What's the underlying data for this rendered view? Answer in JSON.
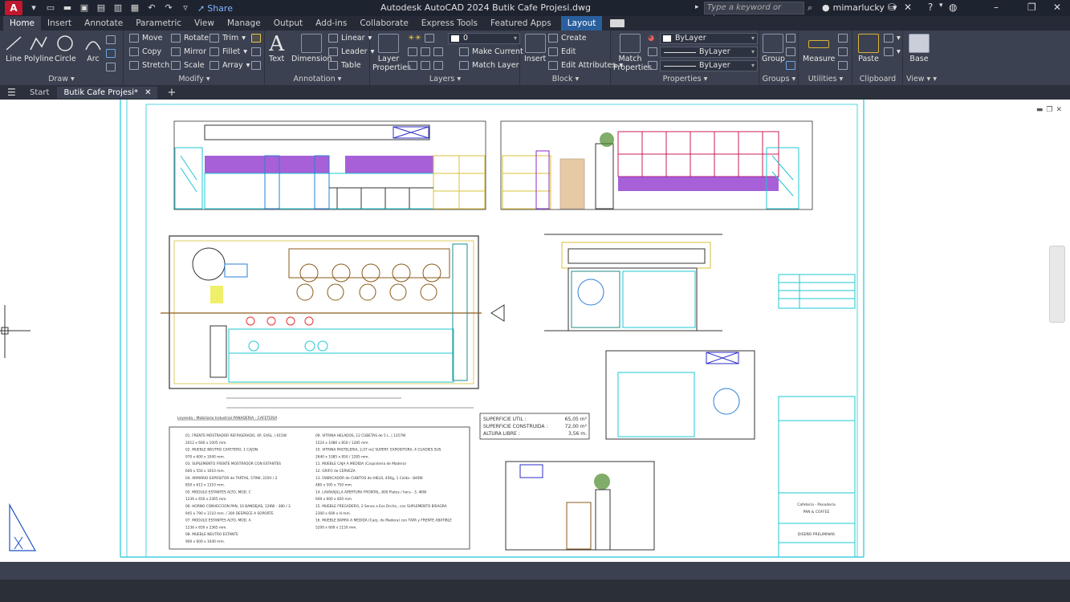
{
  "app": {
    "logo_letter": "A",
    "title": "Autodesk AutoCAD 2024    Butik Cafe Projesi.dwg",
    "share_label": "Share",
    "search_placeholder": "Type a keyword or phrase",
    "user_name": "mimarlucky"
  },
  "ribbon_tabs": [
    "Home",
    "Insert",
    "Annotate",
    "Parametric",
    "View",
    "Manage",
    "Output",
    "Add-ins",
    "Collaborate",
    "Express Tools",
    "Featured Apps",
    "Layout"
  ],
  "ribbon": {
    "draw": {
      "label": "Draw",
      "line": "Line",
      "polyline": "Polyline",
      "circle": "Circle",
      "arc": "Arc"
    },
    "modify": {
      "label": "Modify",
      "move": "Move",
      "rotate": "Rotate",
      "trim": "Trim",
      "copy": "Copy",
      "mirror": "Mirror",
      "fillet": "Fillet",
      "stretch": "Stretch",
      "scale": "Scale",
      "array": "Array"
    },
    "annotation": {
      "label": "Annotation",
      "text": "Text",
      "dimension": "Dimension",
      "linear": "Linear",
      "leader": "Leader",
      "table": "Table"
    },
    "layers": {
      "label": "Layers",
      "layer_properties": "Layer Properties",
      "current_layer": "0",
      "make_current": "Make Current",
      "match_layer": "Match Layer"
    },
    "block": {
      "label": "Block",
      "insert": "Insert",
      "create": "Create",
      "edit": "Edit",
      "edit_attributes": "Edit Attributes"
    },
    "properties": {
      "label": "Properties",
      "match_properties": "Match Properties",
      "color": "ByLayer",
      "linetype": "ByLayer",
      "lineweight": "ByLayer"
    },
    "groups": {
      "label": "Groups",
      "group": "Group"
    },
    "utilities": {
      "label": "Utilities",
      "measure": "Measure"
    },
    "clipboard": {
      "label": "Clipboard",
      "paste": "Paste"
    },
    "view": {
      "label": "View",
      "base": "Base"
    }
  },
  "file_tabs": {
    "start": "Start",
    "active": "Butik Cafe Projesi*"
  },
  "drawing": {
    "legend_title": "Leyenda - Mobiliario Industrial PANADERIA - CAFETERIA",
    "legend_left": [
      "01. FRENTE MOSTRADOR REFRIGERADO, 4P, EXSL. | 615W",
      "2012 x 600 x 1005 mm.",
      "02. MUEBLE NEUTRO CAFETERO, 1 CAJON",
      "970 x 600 x 1040 mm.",
      "03. SUPLEMENTO FRENTE MOSTRADOR CON ESTANTES",
      "600 x 550 x 1010 mm.",
      "04. ARMARIO EXPOSITOR de TARTAS, 579W, 220V / 2",
      "850 x 615 x 1310 mm.",
      "05. MODULO ESTANTES ALTO, MOD. C",
      "1236 x 650 x 2365 mm.",
      "06. HORNO CONVECCION PAN, 10 BANDEJAS, 12KW - 380 / 3",
      "945 x 790 x 1110 mm. / 300 DESPIECE A SOPORTE",
      "07. MODULO ESTANTES ALTO, MOD. A",
      "1236 x 650 x 2365 mm.",
      "08. MUEBLE NEUTRO ESTANTE",
      "900 x 600 x 1040 mm."
    ],
    "legend_right": [
      "09. VITRINA HELADOS, 12 CUBETAS de 5 L. | 1357W",
      "1524 x 1086 x 850 / 1285 mm.",
      "10. VITRINA PASTELERIA, 2,07 m2 SUPERF. EXPOSITORA, 4 CUADIES SUS",
      "2640 x 1085 x 850 / 1285 mm.",
      "11. MUEBLE CAJA A MEDIDA (Carpinteria de Madera)",
      "12. GRIFO de CERVEZA",
      "13. FABRICADOR de CUBITOS de HIELO, 45Kg, 1 Celda - 840W",
      "480 x 595 x 750 mm.",
      "14. LAVAVAJILLA APERTURA FRONTAL, 800 Platos / hora - 3, 4KW",
      "600 x 600 x 820 mm.",
      "15. MUEBLE FREGADERO, 2 Senos a Eso Drcha., con SUPLEMENTO BISAGRA",
      "2300 x 600 x H mm.",
      "16. MUEBLE BARRA A MEDIDA (Carp. de Madera) con TAPA y FRENTE ABATIBLE",
      "5200 x 600 x 1150 mm."
    ],
    "area_table": {
      "rows": [
        {
          "label": "SUPERFICIE UTIL :",
          "value": "65,05 m²"
        },
        {
          "label": "SUPERFICIE CONSTRUIDA :",
          "value": "72,00 m²"
        },
        {
          "label": "ALTURA LIBRE :",
          "value": "3,56 m."
        }
      ]
    },
    "title_block": {
      "line1": "Cafeteria - Panaderia",
      "line2": "PAN & COFFEE",
      "line3": "DISEÑO PRELIMINAR"
    }
  },
  "colors": {
    "titlebar": "#1e2330",
    "ribbon": "#3b4150",
    "accent": "#2a5f9e",
    "cad_cyan": "#1ec8d6",
    "cad_purple": "#8a2bc9",
    "cad_yellow": "#d8c23a"
  }
}
